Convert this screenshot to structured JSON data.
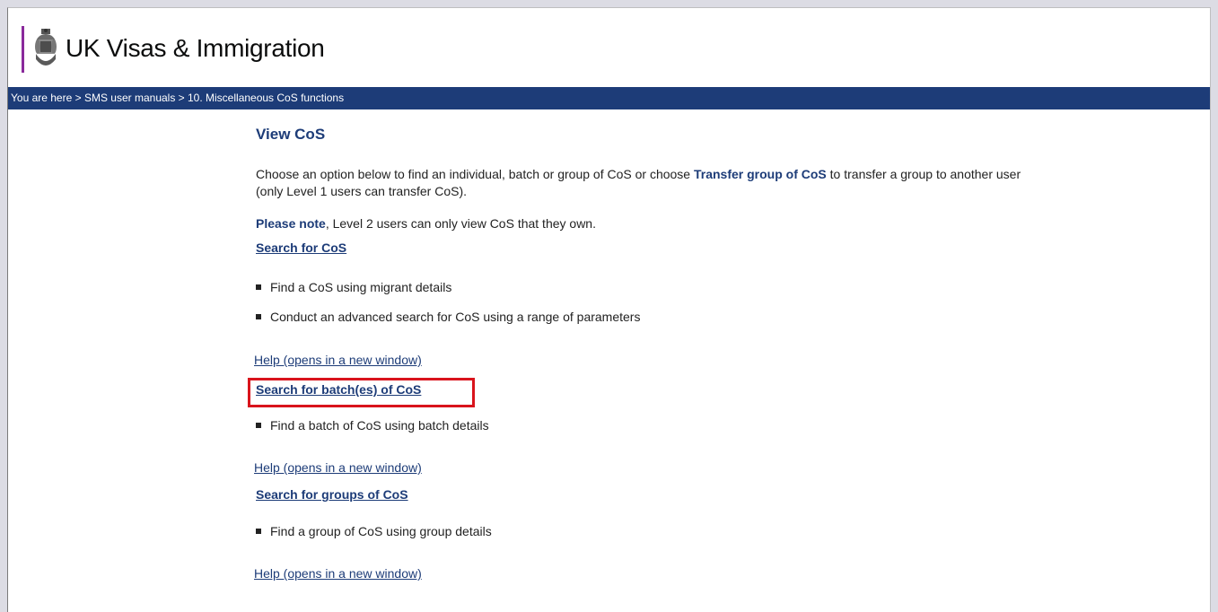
{
  "header": {
    "brand": "UK Visas & Immigration",
    "logo_icon": "royal-crest-icon",
    "accent_color": "#8a2a9b"
  },
  "breadcrumb": {
    "text": "You are here > SMS user manuals > 10. Miscellaneous CoS functions",
    "bar_color": "#1d3c78"
  },
  "main": {
    "title": "View CoS",
    "intro_part1": "Choose an option below to find an individual, batch or group of CoS or choose ",
    "intro_bold": "Transfer group of CoS",
    "intro_part2": " to transfer a group to another user (only Level 1 users can transfer CoS).",
    "note_bold": "Please note",
    "note_text": ", Level 2 users can only view CoS that they own.",
    "sections": [
      {
        "link": "Search for CoS",
        "bullets": [
          "Find a CoS using migrant details",
          "Conduct an advanced search for CoS using a range of parameters"
        ],
        "help": "Help (opens in a new window)"
      },
      {
        "link": "Search for batch(es) of CoS",
        "bullets": [
          "Find a batch of CoS using batch details"
        ],
        "help": "Help (opens in a new window)",
        "highlighted": true
      },
      {
        "link": "Search for groups of CoS",
        "bullets": [
          "Find a group of CoS using group details"
        ],
        "help": "Help (opens in a new window)"
      }
    ]
  },
  "highlight_color": "#d9141c"
}
